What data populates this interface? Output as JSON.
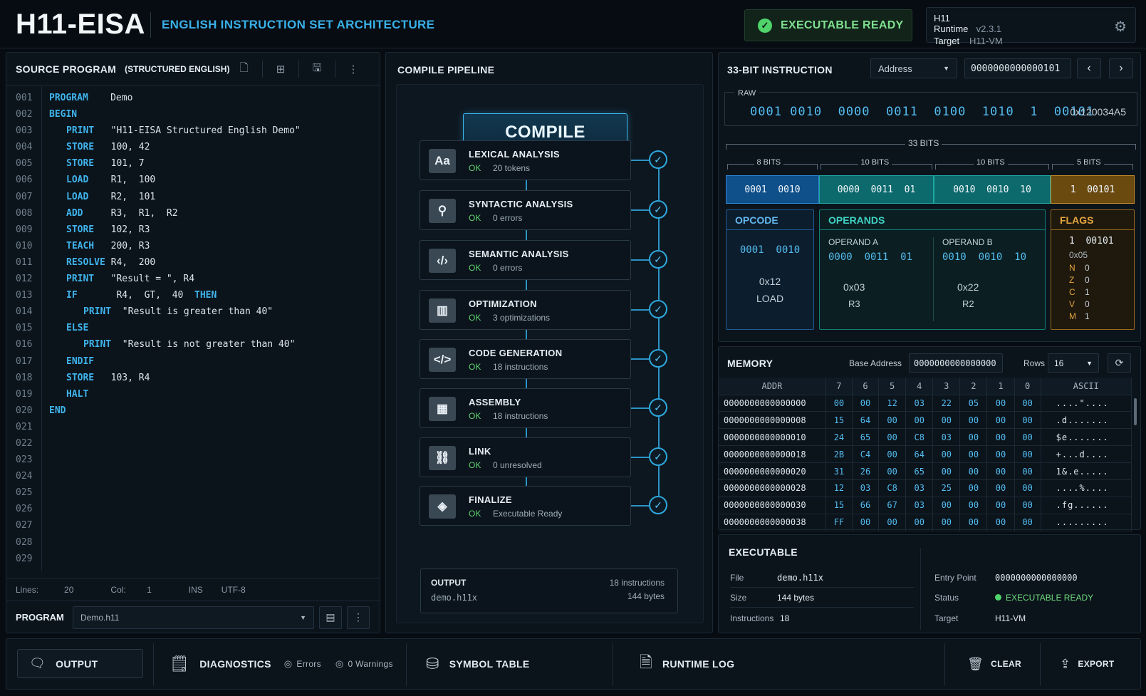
{
  "header": {
    "logo": "H11-EISA",
    "subtitle": "ENGLISH INSTRUCTION SET ARCHITECTURE",
    "status": "EXECUTABLE READY",
    "runtime_label": "H11 Runtime",
    "runtime_version": "v2.3.1",
    "target_label": "Target",
    "target_value": "H11-VM"
  },
  "source": {
    "title": "SOURCE PROGRAM",
    "subtitle": "(STRUCTURED ENGLISH)",
    "line_numbers": [
      "001",
      "002",
      "003",
      "004",
      "005",
      "006",
      "007",
      "008",
      "009",
      "010",
      "011",
      "012",
      "013",
      "014",
      "015",
      "016",
      "017",
      "018",
      "019",
      "020",
      "021",
      "022",
      "023",
      "024",
      "025",
      "026",
      "027",
      "028",
      "029"
    ],
    "lines": [
      {
        "indent": 0,
        "kw": "PROGRAM",
        "rest": "    Demo"
      },
      {
        "indent": 0,
        "kw": "BEGIN",
        "rest": ""
      },
      {
        "indent": 1,
        "kw": "PRINT",
        "rest": "   \"H11-EISA Structured English Demo\""
      },
      {
        "indent": 1,
        "kw": "STORE",
        "rest": "   100, 42"
      },
      {
        "indent": 1,
        "kw": "STORE",
        "rest": "   101, 7"
      },
      {
        "indent": 1,
        "kw": "LOAD",
        "rest": "    R1,  100"
      },
      {
        "indent": 1,
        "kw": "LOAD",
        "rest": "    R2,  101"
      },
      {
        "indent": 1,
        "kw": "ADD",
        "rest": "     R3,  R1,  R2"
      },
      {
        "indent": 1,
        "kw": "STORE",
        "rest": "   102, R3"
      },
      {
        "indent": 1,
        "kw": "TEACH",
        "rest": "   200, R3"
      },
      {
        "indent": 1,
        "kw": "RESOLVE",
        "rest": " R4,  200"
      },
      {
        "indent": 1,
        "kw": "PRINT",
        "rest": "   \"Result = \", R4"
      },
      {
        "indent": 1,
        "kw": "IF",
        "rest": "       R4,  GT,  40  ",
        "kw2": "THEN"
      },
      {
        "indent": 2,
        "kw": "PRINT",
        "rest": "  \"Result is greater than 40\""
      },
      {
        "indent": 1,
        "kw": "ELSE",
        "rest": ""
      },
      {
        "indent": 2,
        "kw": "PRINT",
        "rest": "  \"Result is not greater than 40\""
      },
      {
        "indent": 1,
        "kw": "ENDIF",
        "rest": ""
      },
      {
        "indent": 1,
        "kw": "STORE",
        "rest": "   103, R4"
      },
      {
        "indent": 1,
        "kw": "HALT",
        "rest": ""
      },
      {
        "indent": 0,
        "kw": "END",
        "rest": ""
      }
    ],
    "status": {
      "lines_label": "Lines:",
      "lines_value": "20",
      "col_label": "Col:",
      "col_value": "1",
      "mode": "INS",
      "encoding": "UTF-8"
    },
    "program_label": "PROGRAM",
    "program_value": "Demo.h11"
  },
  "pipeline": {
    "title": "COMPILE PIPELINE",
    "compile_label": "COMPILE",
    "stages": [
      {
        "name": "LEXICAL ANALYSIS",
        "status": "OK",
        "detail": "20 tokens",
        "icon": "Aa"
      },
      {
        "name": "SYNTACTIC ANALYSIS",
        "status": "OK",
        "detail": "0 errors",
        "icon": "⚲"
      },
      {
        "name": "SEMANTIC ANALYSIS",
        "status": "OK",
        "detail": "0 errors",
        "icon": "‹/›"
      },
      {
        "name": "OPTIMIZATION",
        "status": "OK",
        "detail": "3 optimizations",
        "icon": "▥"
      },
      {
        "name": "CODE GENERATION",
        "status": "OK",
        "detail": "18 instructions",
        "icon": "</>"
      },
      {
        "name": "ASSEMBLY",
        "status": "OK",
        "detail": "18 instructions",
        "icon": "▦"
      },
      {
        "name": "LINK",
        "status": "OK",
        "detail": "0 unresolved",
        "icon": "⛓"
      },
      {
        "name": "FINALIZE",
        "status": "OK",
        "detail": "Executable Ready",
        "icon": "◈"
      }
    ],
    "output": {
      "label": "OUTPUT",
      "file": "demo.h11x",
      "instructions": "18 instructions",
      "bytes": "144 bytes"
    }
  },
  "instruction": {
    "title": "33-BIT INSTRUCTION",
    "mode": "Address",
    "address": "0000000000000101",
    "raw_label": "RAW",
    "raw_bits": "0001 0010  0000  0011  0100  1010  1  00101",
    "raw_hex": "0x120034A5",
    "total_bits": "33 BITS",
    "segments": [
      {
        "label": "8 BITS",
        "bits": "0001  0010",
        "color": "#0f4f8a"
      },
      {
        "label": "10 BITS",
        "bits": "0000  0011  01",
        "color": "#0d6a6c"
      },
      {
        "label": "10 BITS",
        "bits": "0010  0010  10",
        "color": "#0d6a6c"
      },
      {
        "label": "5 BITS",
        "bits": "1  00101",
        "color": "#6b4a10"
      }
    ],
    "opcode": {
      "title": "OPCODE",
      "bits": "0001  0010",
      "hex": "0x12",
      "mnemonic": "LOAD"
    },
    "operands": {
      "title": "OPERANDS",
      "a": {
        "label": "OPERAND A",
        "bits": "0000  0011  01",
        "hex": "0x03",
        "reg": "R3"
      },
      "b": {
        "label": "OPERAND B",
        "bits": "0010  0010  10",
        "hex": "0x22",
        "reg": "R2"
      }
    },
    "flags": {
      "title": "FLAGS",
      "bits": "1  00101",
      "hex": "0x05",
      "items": [
        {
          "k": "N",
          "v": "0"
        },
        {
          "k": "Z",
          "v": "0"
        },
        {
          "k": "C",
          "v": "1"
        },
        {
          "k": "V",
          "v": "0"
        },
        {
          "k": "M",
          "v": "1"
        }
      ]
    }
  },
  "memory": {
    "title": "MEMORY",
    "base_label": "Base Address",
    "base_value": "0000000000000000",
    "rows_label": "Rows",
    "rows_value": "16",
    "columns": [
      "ADDR",
      "7",
      "6",
      "5",
      "4",
      "3",
      "2",
      "1",
      "0",
      "ASCII"
    ],
    "rows": [
      [
        "0000000000000000",
        "00",
        "00",
        "12",
        "03",
        "22",
        "05",
        "00",
        "00",
        "....\"...."
      ],
      [
        "0000000000000008",
        "15",
        "64",
        "00",
        "00",
        "00",
        "00",
        "00",
        "00",
        ".d......."
      ],
      [
        "0000000000000010",
        "24",
        "65",
        "00",
        "C8",
        "03",
        "00",
        "00",
        "00",
        "$e......."
      ],
      [
        "0000000000000018",
        "2B",
        "C4",
        "00",
        "64",
        "00",
        "00",
        "00",
        "00",
        "+...d...."
      ],
      [
        "0000000000000020",
        "31",
        "26",
        "00",
        "65",
        "00",
        "00",
        "00",
        "00",
        "1&.e....."
      ],
      [
        "0000000000000028",
        "12",
        "03",
        "C8",
        "03",
        "25",
        "00",
        "00",
        "00",
        "....%...."
      ],
      [
        "0000000000000030",
        "15",
        "66",
        "67",
        "03",
        "00",
        "00",
        "00",
        "00",
        ".fg......"
      ],
      [
        "0000000000000038",
        "FF",
        "00",
        "00",
        "00",
        "00",
        "00",
        "00",
        "00",
        "........."
      ]
    ]
  },
  "executable": {
    "title": "EXECUTABLE",
    "file_label": "File",
    "file": "demo.h11x",
    "size_label": "Size",
    "size": "144 bytes",
    "instr_label": "Instructions",
    "instr": "18",
    "entry_label": "Entry Point",
    "entry": "0000000000000000",
    "status_label": "Status",
    "status": "EXECUTABLE READY",
    "target_label": "Target",
    "target": "H11-VM"
  },
  "bottom": {
    "output": "OUTPUT",
    "diagnostics": "DIAGNOSTICS",
    "errors": "Errors",
    "warnings": "0 Warnings",
    "symbol_table": "SYMBOL TABLE",
    "runtime_log": "RUNTIME LOG",
    "clear": "CLEAR",
    "export": "EXPORT"
  },
  "colors": {
    "accent": "#3fb4ec",
    "ok": "#5fd36f",
    "flags": "#d6962a",
    "operands": "#1bb0a8"
  }
}
